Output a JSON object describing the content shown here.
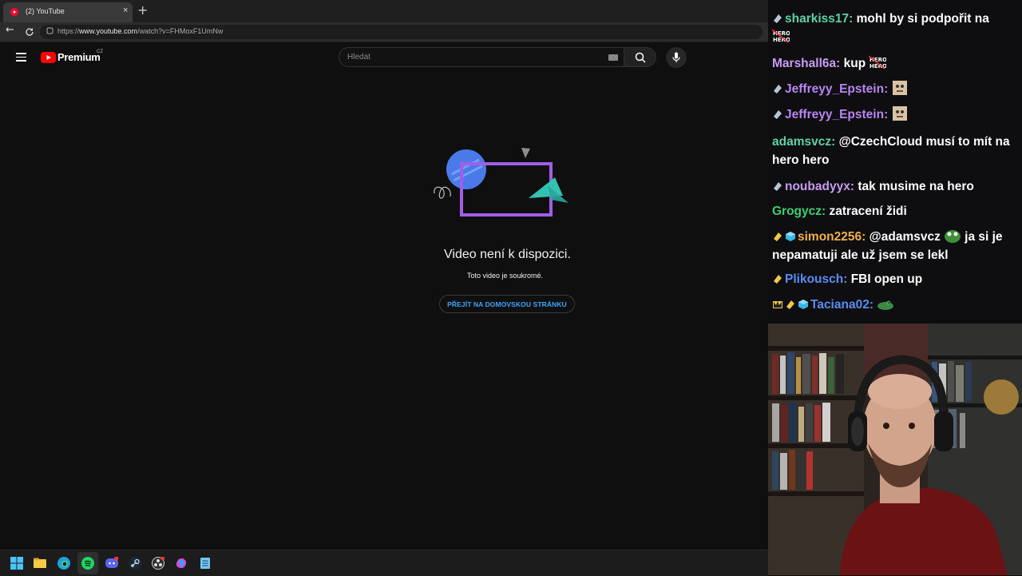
{
  "browser": {
    "tab_title": "(2) YouTube",
    "tab_close": "×",
    "new_tab": "+",
    "url_prefix": "https://",
    "url_main": "www.youtube.com",
    "url_path": "/watch?v=FHMoxF1UmNw"
  },
  "youtube": {
    "brand": "Premium",
    "country": "CZ",
    "search_placeholder": "Hledat",
    "error_title": "Video není k dispozici.",
    "error_subtitle": "Toto video je soukromé.",
    "home_button": "PŘEJÍT NA DOMOVSKOU STRÁNKU"
  },
  "chat": {
    "messages": [
      {
        "user": "sharkiss17",
        "color": "#5cd0a8",
        "text": "mohl by si podpořit na",
        "badges": [
          "sub-badge"
        ],
        "emote_after": "herohero-emote"
      },
      {
        "user": "Marshall6a",
        "color": "#c89cf5",
        "text": "kup",
        "badges": [],
        "emote_after": "herohero-emote"
      },
      {
        "user": "Jeffreyy_Epstein",
        "color": "#b685f0",
        "text": "",
        "badges": [
          "sub-badge"
        ],
        "emote_after": "face-emote"
      },
      {
        "user": "Jeffreyy_Epstein",
        "color": "#b685f0",
        "text": "",
        "badges": [
          "sub-badge"
        ],
        "emote_after": "face-emote"
      },
      {
        "user": "adamsvcz",
        "color": "#5cd0a8",
        "text": "@CzechCloud musí to mít na hero hero",
        "badges": []
      },
      {
        "user": "noubadyyx",
        "color": "#c89cf5",
        "text": "tak musime na hero",
        "badges": [
          "sub-badge"
        ]
      },
      {
        "user": "Grogycz",
        "color": "#3ccf73",
        "text": "zatracení židi",
        "badges": []
      },
      {
        "user": "simon2256",
        "color": "#f2b04c",
        "text": "@adamsvcz",
        "text2": "ja si je nepamatuji ale už jsem se lekl",
        "badges": [
          "gold-badge",
          "cube-badge"
        ],
        "emote_after": "pepe-emote"
      },
      {
        "user": "Plikousch",
        "color": "#5a8cf5",
        "text": "FBI open up",
        "badges": [
          "gold-badge"
        ]
      },
      {
        "user": "Taciana02",
        "color": "#5a8cf5",
        "text": "",
        "badges": [
          "crown-badge",
          "gold-badge",
          "cube-badge"
        ],
        "emote_after": "croc-emote"
      }
    ],
    "separator": ":"
  },
  "colors": {
    "accent_blue": "#3ea6ff",
    "yt_red": "#ff0000"
  }
}
